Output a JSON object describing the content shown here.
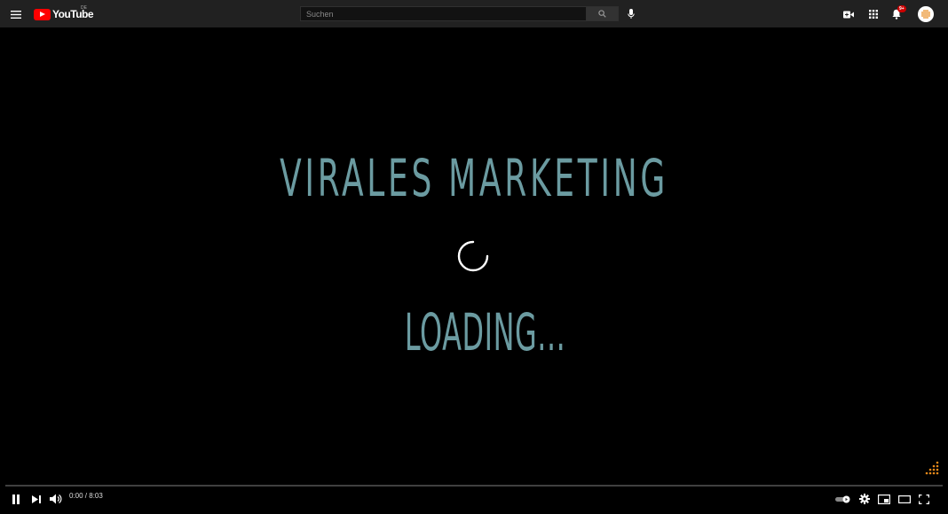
{
  "header": {
    "logo_text": "YouTube",
    "country_code": "DE",
    "search_placeholder": "Suchen",
    "notification_count": "9+",
    "icons": [
      "menu-icon",
      "search-icon",
      "mic-icon",
      "create-video-icon",
      "apps-grid-icon",
      "bell-icon"
    ]
  },
  "video": {
    "title_overlay": "VIRALES MARKETING",
    "loading_overlay": "LOADING...",
    "accent_color": "#6b9ba1"
  },
  "player": {
    "current_time": "0:00",
    "separator": " / ",
    "duration": "8:03",
    "progress": 0,
    "autoplay_on": true,
    "icons": [
      "pause-icon",
      "next-icon",
      "volume-icon",
      "autoplay-toggle-icon",
      "settings-gear-icon",
      "miniplayer-icon",
      "theater-mode-icon",
      "fullscreen-icon"
    ]
  }
}
